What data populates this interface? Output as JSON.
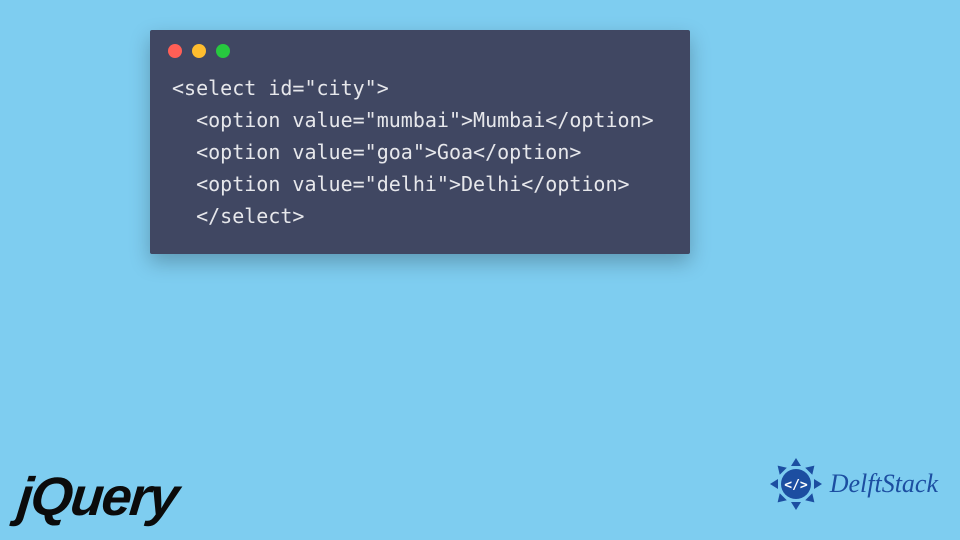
{
  "code": {
    "line1": "<select id=\"city\">",
    "line2": "  <option value=\"mumbai\">Mumbai</option>",
    "line3": "  <option value=\"goa\">Goa</option>",
    "line4": "  <option value=\"delhi\">Delhi</option>",
    "line5": "  </select>"
  },
  "logos": {
    "jquery": "jQuery",
    "delftstack": "DelftStack",
    "delftstack_badge": "</>"
  }
}
